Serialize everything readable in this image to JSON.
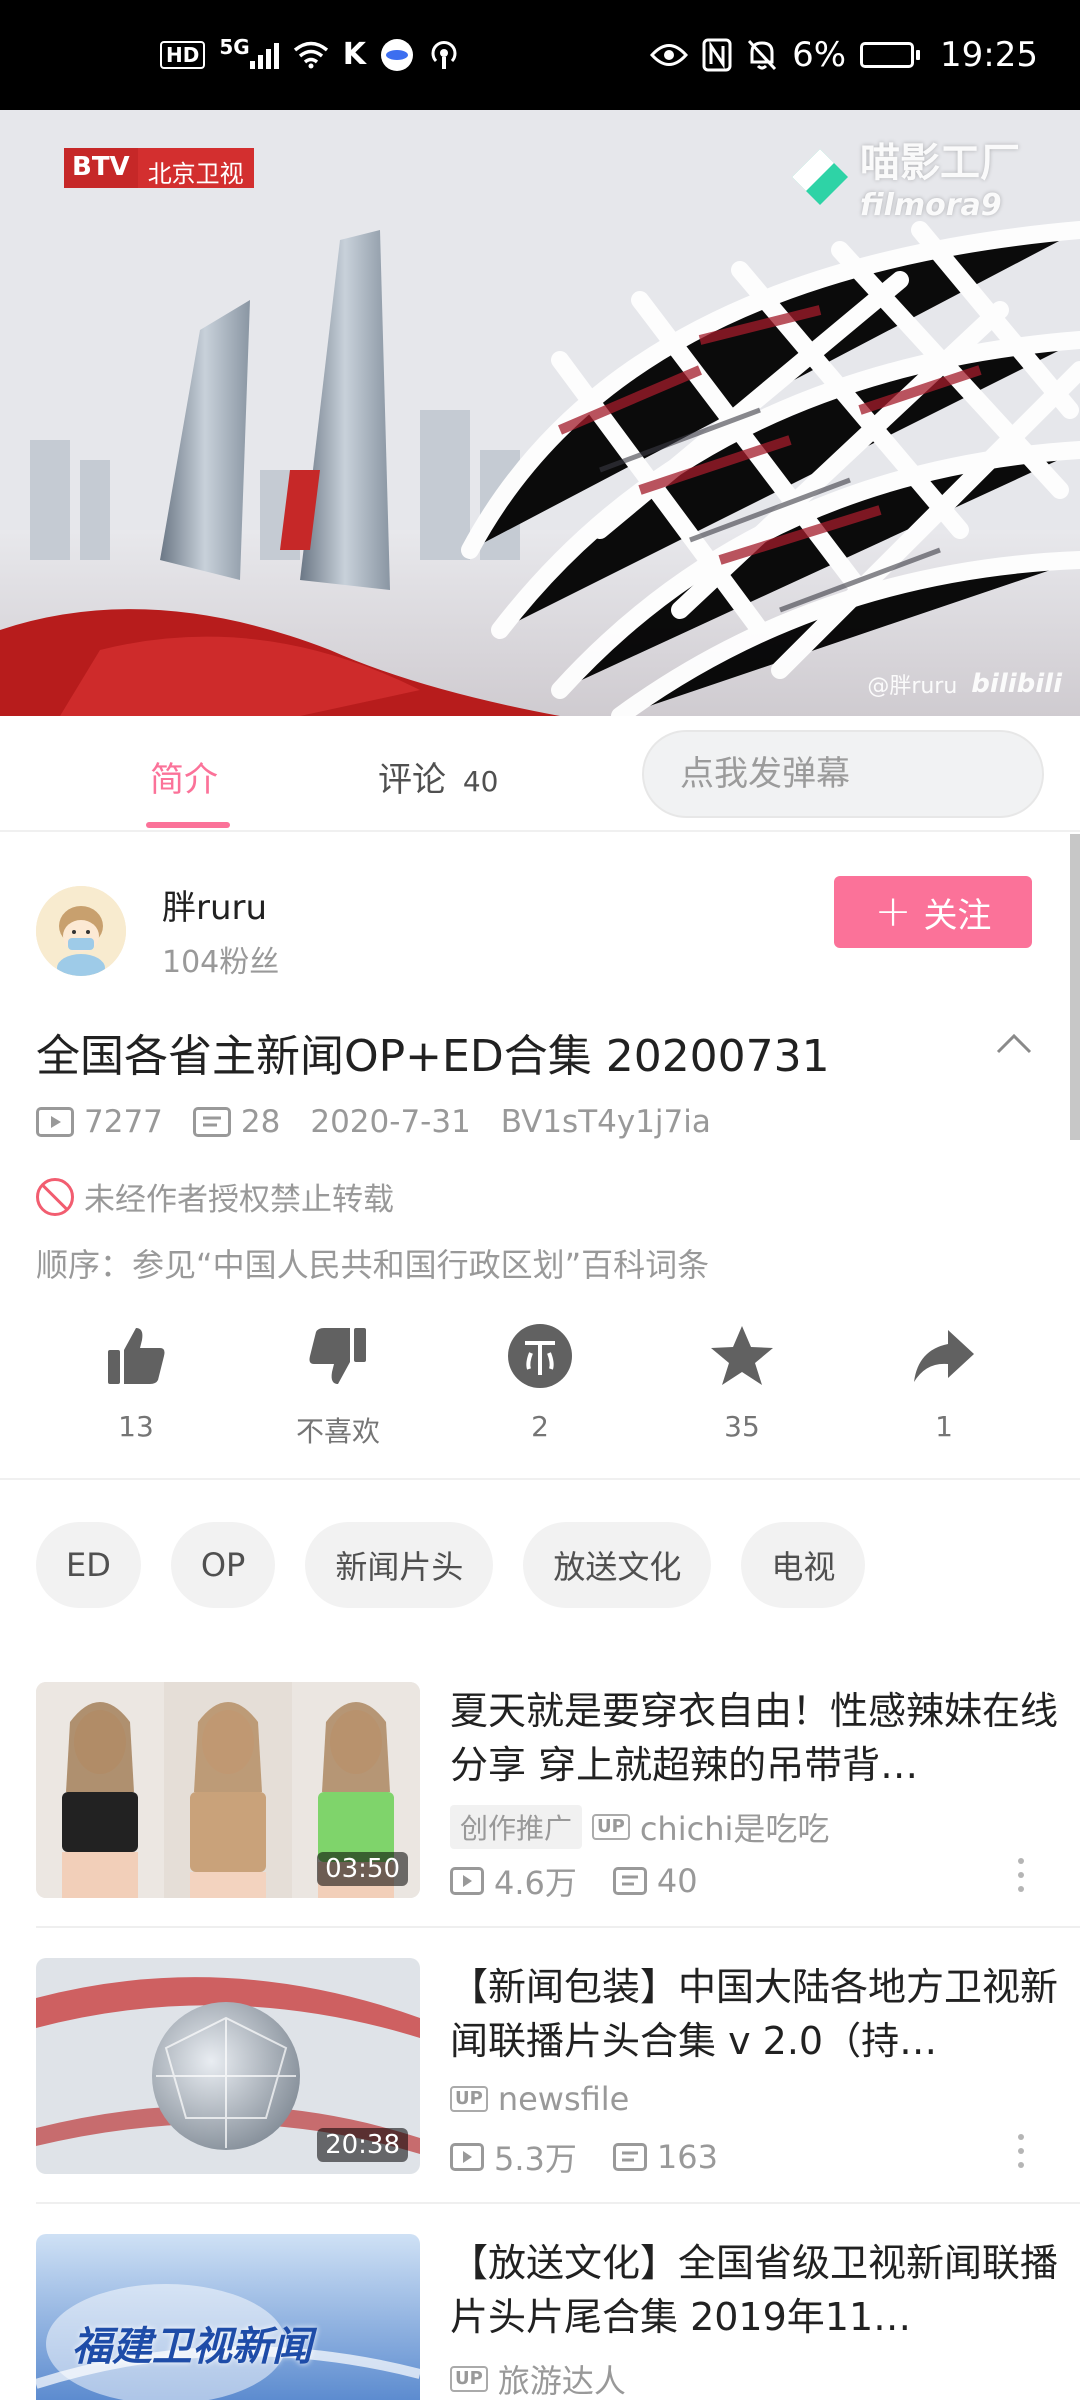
{
  "status_bar": {
    "battery_percent": "6%",
    "battery_level": 0.06,
    "time": "19:25",
    "icons": [
      "hd-icon",
      "5g-signal-icon",
      "wifi-icon",
      "k-icon",
      "app-icon",
      "hotspot-icon",
      "eye-icon",
      "nfc-icon",
      "mute-icon",
      "battery-icon"
    ]
  },
  "video": {
    "channel_logo_en": "BTV",
    "channel_logo_cn": "北京卫视",
    "watermark_cn": "喵影工厂",
    "watermark_en": "filmora9",
    "corner_user": "@胖ruru",
    "corner_brand": "bilibili"
  },
  "tabs": {
    "intro": "简介",
    "comments": "评论",
    "comments_count": "40"
  },
  "danmaku": {
    "placeholder": "点我发弹幕",
    "icon_char": "弹"
  },
  "uploader": {
    "name": "胖ruru",
    "fans": "104粉丝",
    "follow_label": "关注"
  },
  "video_info": {
    "title": "全国各省主新闻OP+ED合集 20200731",
    "views": "7277",
    "danmaku_count": "28",
    "date": "2020-7-31",
    "bvid": "BV1sT4y1j7ia",
    "no_repost": "未经作者授权禁止转载",
    "description": "顺序：参见“中国人民共和国行政区划”百科词条"
  },
  "actions": {
    "like": "13",
    "dislike": "不喜欢",
    "coin": "2",
    "favorite": "35",
    "share": "1"
  },
  "tags": [
    "ED",
    "OP",
    "新闻片头",
    "放送文化",
    "电视"
  ],
  "recommendations": [
    {
      "title": "夏天就是要穿衣自由！性感辣妹在线分享 穿上就超辣的吊带背…",
      "promo": "创作推广",
      "up_badge": "UP",
      "uploader": "chichi是吃吃",
      "views": "4.6万",
      "danmaku": "40",
      "duration": "03:50"
    },
    {
      "title": "【新闻包装】中国大陆各地方卫视新闻联播片头合集 v 2.0（持…",
      "up_badge": "UP",
      "uploader": "newsfile",
      "views": "5.3万",
      "danmaku": "163",
      "duration": "20:38"
    },
    {
      "title": "【放送文化】全国省级卫视新闻联播片头片尾合集 2019年11…",
      "up_badge": "UP",
      "uploader": "旅游达人",
      "thumb_text": "福建卫视新闻"
    }
  ],
  "colors": {
    "accent": "#fb7299",
    "text_primary": "#212121",
    "text_secondary": "#999999",
    "status_bar_bg": "#000000"
  }
}
